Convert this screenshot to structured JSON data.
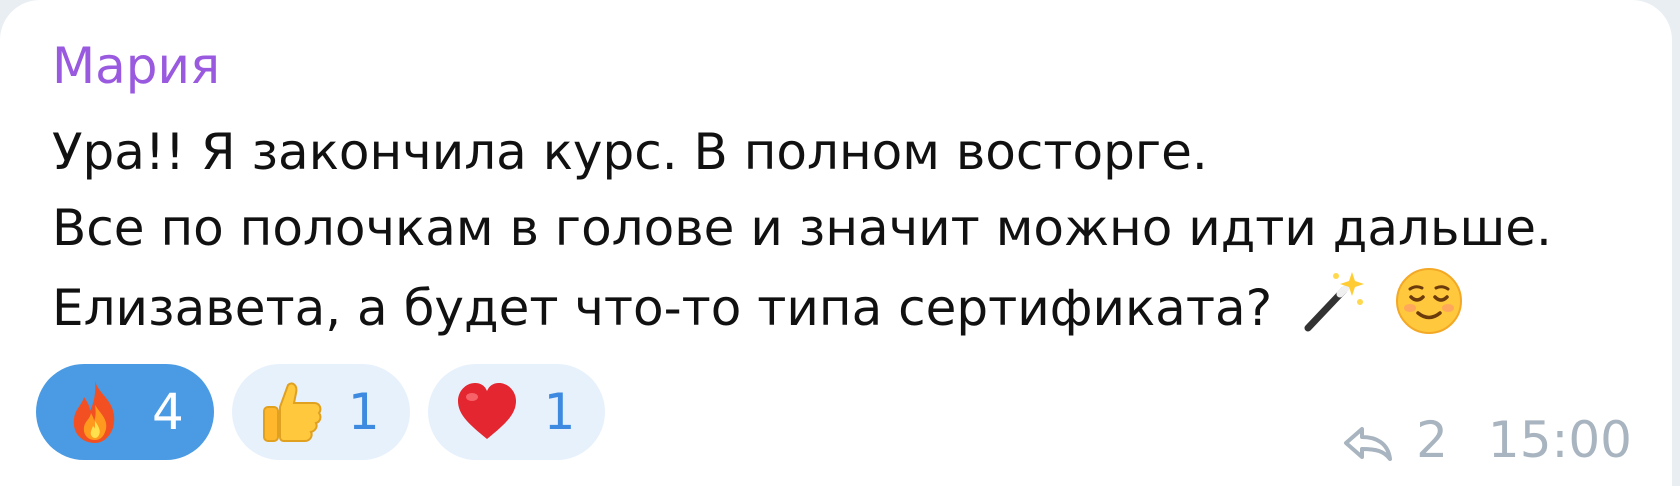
{
  "message": {
    "sender": "Мария",
    "lines": [
      "Ура!! Я закончила курс. В полном восторге.",
      "Все по полочкам в голове и значит можно идти дальше.",
      "Елизавета, а будет что-то типа сертификата?"
    ],
    "trailing_emojis": [
      "magic-wand-emoji",
      "relieved-face-emoji"
    ]
  },
  "reactions": [
    {
      "icon": "fire-emoji",
      "count": "4",
      "active": true
    },
    {
      "icon": "thumbs-up-emoji",
      "count": "1",
      "active": false
    },
    {
      "icon": "red-heart-emoji",
      "count": "1",
      "active": false
    }
  ],
  "meta": {
    "reply_icon": "reply-arrow-icon",
    "reply_count": "2",
    "time": "15:00"
  },
  "colors": {
    "sender": "#9a5ae0",
    "active_reaction": "#4a9be3",
    "inactive_reaction": "#e7f1fc",
    "meta": "#a8b4bf"
  }
}
